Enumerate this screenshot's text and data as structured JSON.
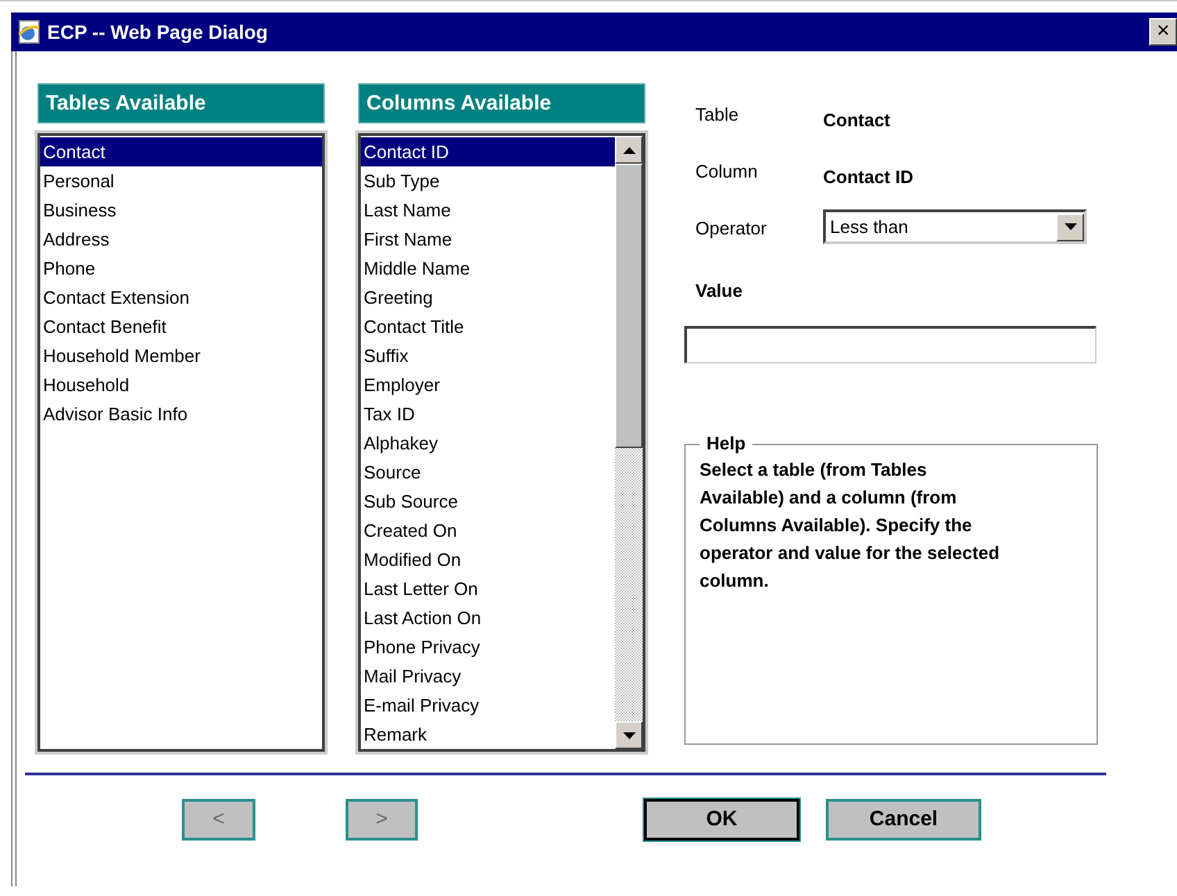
{
  "window": {
    "title": "ECP -- Web Page Dialog",
    "close": "×"
  },
  "tables": {
    "header": "Tables Available",
    "items": [
      {
        "label": "Contact",
        "selected": true
      },
      {
        "label": "Personal",
        "selected": false
      },
      {
        "label": "Business",
        "selected": false
      },
      {
        "label": "Address",
        "selected": false
      },
      {
        "label": "Phone",
        "selected": false
      },
      {
        "label": "Contact Extension",
        "selected": false
      },
      {
        "label": "Contact Benefit",
        "selected": false
      },
      {
        "label": "Household Member",
        "selected": false
      },
      {
        "label": "Household",
        "selected": false
      },
      {
        "label": "Advisor Basic Info",
        "selected": false
      }
    ]
  },
  "columns": {
    "header": "Columns Available",
    "items": [
      {
        "label": "Contact ID",
        "selected": true
      },
      {
        "label": "Sub Type",
        "selected": false
      },
      {
        "label": "Last Name",
        "selected": false
      },
      {
        "label": "First Name",
        "selected": false
      },
      {
        "label": "Middle Name",
        "selected": false
      },
      {
        "label": "Greeting",
        "selected": false
      },
      {
        "label": "Contact Title",
        "selected": false
      },
      {
        "label": "Suffix",
        "selected": false
      },
      {
        "label": "Employer",
        "selected": false
      },
      {
        "label": "Tax ID",
        "selected": false
      },
      {
        "label": "Alphakey",
        "selected": false
      },
      {
        "label": "Source",
        "selected": false
      },
      {
        "label": "Sub Source",
        "selected": false
      },
      {
        "label": "Created On",
        "selected": false
      },
      {
        "label": "Modified On",
        "selected": false
      },
      {
        "label": "Last Letter On",
        "selected": false
      },
      {
        "label": "Last Action On",
        "selected": false
      },
      {
        "label": "Phone Privacy",
        "selected": false
      },
      {
        "label": "Mail Privacy",
        "selected": false
      },
      {
        "label": "E-mail Privacy",
        "selected": false
      },
      {
        "label": "Remark",
        "selected": false
      }
    ]
  },
  "details": [
    {
      "label": "Table",
      "value": "Contact"
    },
    {
      "label": "Column",
      "value": "Contact ID"
    }
  ],
  "operator": {
    "label": "Operator",
    "value": "Less than"
  },
  "value_field": {
    "label": "Value"
  },
  "help": {
    "title": "Help",
    "text": "Select a table (from Tables Available) and a column (from Columns Available). Specify the operator and value for the selected column."
  },
  "buttons": [
    {
      "label": "<",
      "kind": "nav",
      "disabled": true
    },
    {
      "label": ">",
      "kind": "nav",
      "disabled": true
    },
    {
      "label": "OK",
      "kind": "default",
      "disabled": false
    },
    {
      "label": "Cancel",
      "kind": "normal",
      "disabled": false
    }
  ]
}
